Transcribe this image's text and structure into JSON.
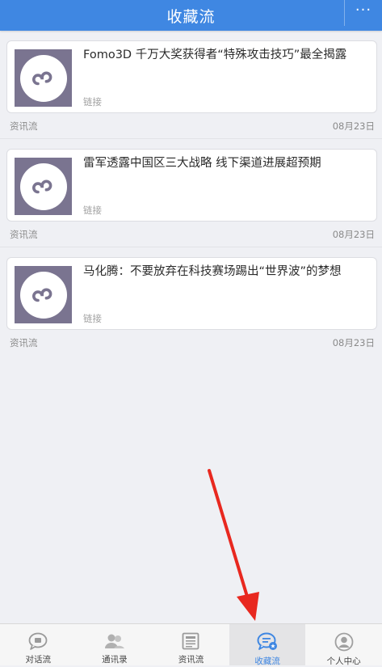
{
  "header": {
    "title": "收藏流",
    "more_label": "···"
  },
  "feed": {
    "items": [
      {
        "title": "Fomo3D 千万大奖获得者“特殊攻击技巧”最全揭露",
        "tag": "链接",
        "source": "资讯流",
        "date": "08月23日"
      },
      {
        "title": "雷军透露中国区三大战略 线下渠道进展超预期",
        "tag": "链接",
        "source": "资讯流",
        "date": "08月23日"
      },
      {
        "title": "马化腾：不要放弃在科技赛场踢出“世界波”的梦想",
        "tag": "链接",
        "source": "资讯流",
        "date": "08月23日"
      }
    ]
  },
  "tabbar": {
    "tabs": [
      {
        "label": "对话流",
        "icon": "chat-bubble-icon"
      },
      {
        "label": "通讯录",
        "icon": "contacts-icon"
      },
      {
        "label": "资讯流",
        "icon": "news-icon"
      },
      {
        "label": "收藏流",
        "icon": "favorites-chat-icon"
      },
      {
        "label": "个人中心",
        "icon": "profile-icon"
      }
    ],
    "active_index": 3
  },
  "colors": {
    "brand": "#3f87e2",
    "annotation_arrow": "#e8281f",
    "thumb_bg": "#7a7490"
  }
}
